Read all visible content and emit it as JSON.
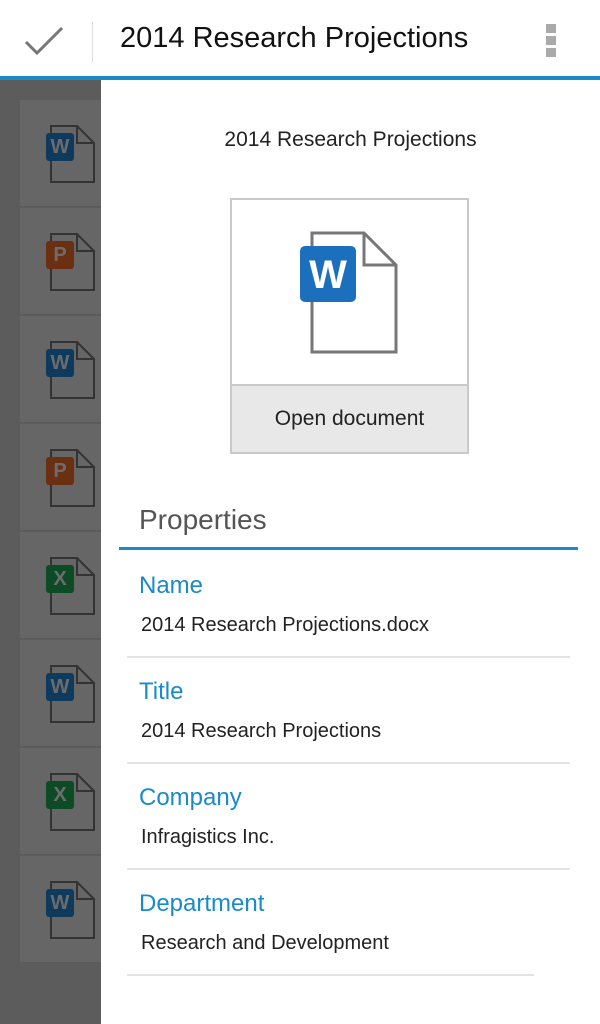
{
  "header": {
    "title": "2014 Research Projections",
    "done_icon": "check-icon",
    "menu_icon": "overflow-menu-icon"
  },
  "file_list": [
    {
      "type": "word",
      "letter": "W"
    },
    {
      "type": "powerpoint",
      "letter": "P"
    },
    {
      "type": "word",
      "letter": "W"
    },
    {
      "type": "powerpoint",
      "letter": "P"
    },
    {
      "type": "excel",
      "letter": "X"
    },
    {
      "type": "word",
      "letter": "W"
    },
    {
      "type": "excel",
      "letter": "X"
    },
    {
      "type": "word",
      "letter": "W"
    }
  ],
  "colors": {
    "accent": "#1a8ac9",
    "word": "#1c6fbd",
    "word_dim": "#0e3a5e",
    "powerpoint_dim": "#6b2f12",
    "excel_dim": "#0d4a26"
  },
  "details": {
    "title": "2014 Research Projections",
    "preview_letter": "W",
    "open_label": "Open document",
    "properties_heading": "Properties",
    "properties": [
      {
        "label": "Name",
        "value": "2014 Research Projections.docx"
      },
      {
        "label": "Title",
        "value": "2014 Research Projections"
      },
      {
        "label": "Company",
        "value": "Infragistics Inc."
      },
      {
        "label": "Department",
        "value": "Research and Development"
      }
    ]
  }
}
